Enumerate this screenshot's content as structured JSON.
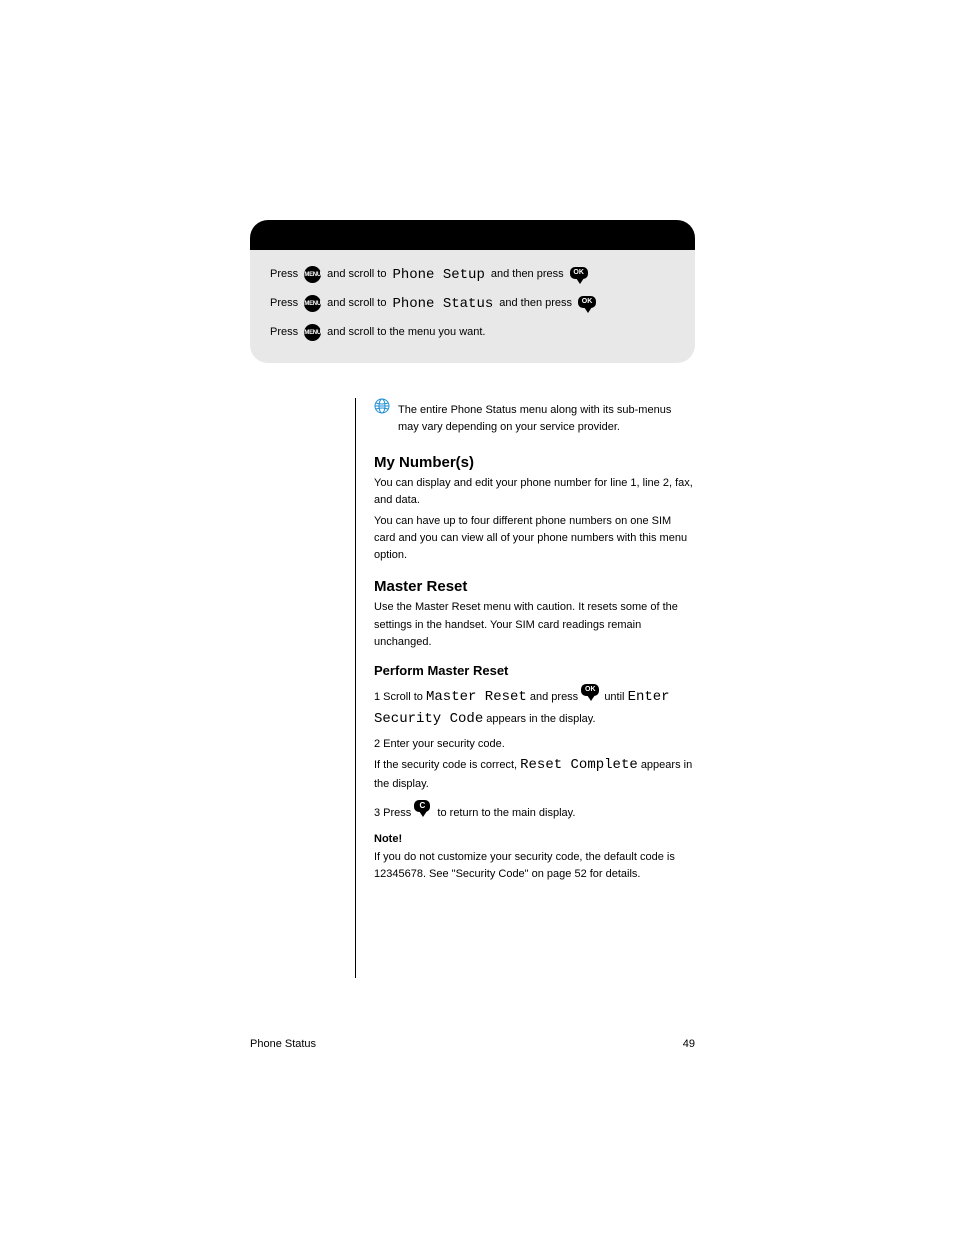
{
  "nav": {
    "rows": [
      {
        "label_menu": "MENU",
        "pre": "Press",
        "scroll_to": "and scroll to",
        "target": "Phone Setup",
        "then_press": "and then press",
        "ok_label": "OK"
      },
      {
        "label_menu": "MENU",
        "pre": "Press",
        "scroll_to": "and scroll to",
        "target": "Phone Status",
        "then_press": "and then press",
        "ok_label": "OK"
      },
      {
        "label_menu": "MENU",
        "pre": "Press",
        "scroll_to": "and scroll to the menu you want."
      }
    ]
  },
  "globe_text": "The entire Phone Status menu along with its sub-menus may vary depending on your service provider.",
  "sections": {
    "h2a": "My Number(s)",
    "p1": "You can display and edit your phone number for line 1, line 2, fax, and data.",
    "p2": "You can have up to four different phone numbers on one SIM card and you can view all of your phone numbers with this menu option.",
    "h2b": "Master Reset",
    "warn": "Use the Master Reset menu with caution. It resets some of the settings in the handset. Your SIM card readings remain unchanged.",
    "h3a": "Perform Master Reset",
    "step1_a": "1 Scroll to",
    "step1_mono": "Master Reset",
    "step1_b": "and press",
    "step1_ok": "OK",
    "step1_c": "until",
    "step1_mono2": "Enter Security Code",
    "step1_d": "appears in the display.",
    "step2_a": "2 Enter your security code.",
    "step2_b": "If the security code is correct,",
    "step2_mono": "Reset Complete",
    "step2_c": "appears in the display.",
    "step3_a": "3 Press",
    "step3_c": "C",
    "step3_b": "to return to the main display.",
    "note_h": "Note!",
    "note_p": "If you do not customize your security code, the default code is 12345678. See \"Security Code\" on page 52 for details."
  },
  "footer": {
    "left": "Phone Status",
    "right": "49"
  }
}
